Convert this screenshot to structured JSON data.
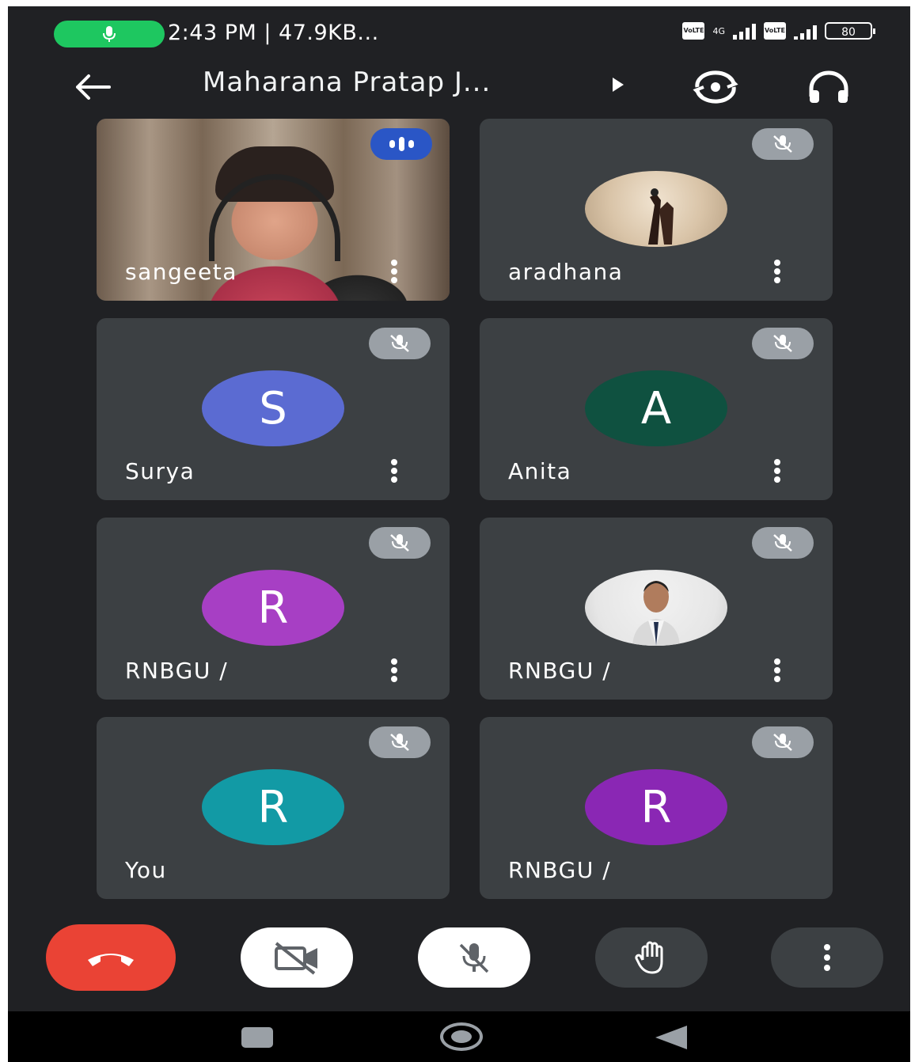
{
  "status_bar": {
    "text": "2:43 PM | 47.9KB...",
    "sim1": "VoLTE",
    "sim2": "VoLTE",
    "network": "4G",
    "battery": "80"
  },
  "header": {
    "title": "Maharana Pratap J..."
  },
  "participants": [
    {
      "name": "sangeeta",
      "type": "video",
      "state": "speaking"
    },
    {
      "name": "aradhana",
      "type": "photo",
      "state": "muted"
    },
    {
      "name": "Surya",
      "type": "initial",
      "initial": "S",
      "color": "#5b6bd2",
      "state": "muted"
    },
    {
      "name": "Anita",
      "type": "initial",
      "initial": "A",
      "color": "#0f5140",
      "state": "muted"
    },
    {
      "name": "RNBGU /",
      "type": "initial",
      "initial": "R",
      "color": "#a73fc4",
      "state": "muted"
    },
    {
      "name": "RNBGU /",
      "type": "photo",
      "state": "muted"
    },
    {
      "name": "You",
      "type": "initial",
      "initial": "R",
      "color": "#129aa5",
      "state": "muted"
    },
    {
      "name": "RNBGU /",
      "type": "initial",
      "initial": "R",
      "color": "#8a27b4",
      "state": "muted"
    }
  ],
  "controls": {
    "end_call_color": "#ea4335"
  }
}
